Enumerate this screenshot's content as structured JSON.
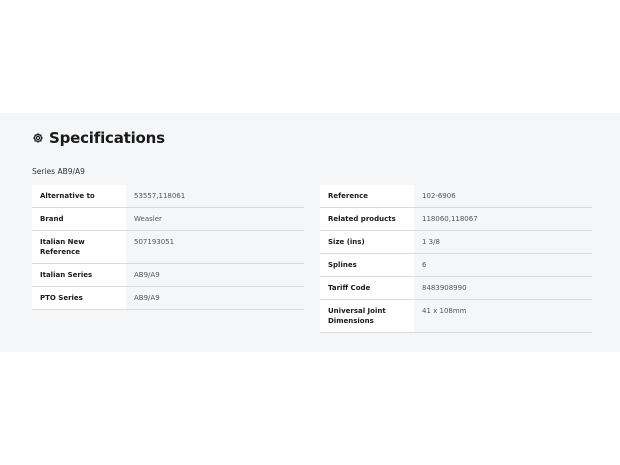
{
  "specs": {
    "title": "Specifications",
    "series_label": "Series AB9/A9",
    "left_rows": [
      {
        "key": "Alternative to",
        "value": "53557,118061"
      },
      {
        "key": "Brand",
        "value": "Weasler"
      },
      {
        "key": "Italian New Reference",
        "value": "507193051"
      },
      {
        "key": "Italian Series",
        "value": "AB9/A9"
      },
      {
        "key": "PTO Series",
        "value": "AB9/A9"
      }
    ],
    "right_rows": [
      {
        "key": "Reference",
        "value": "102-6906"
      },
      {
        "key": "Related products",
        "value": "118060,118067"
      },
      {
        "key": "Size (ins)",
        "value": "1 3/8"
      },
      {
        "key": "Splines",
        "value": "6"
      },
      {
        "key": "Tariff Code",
        "value": "8483908990"
      },
      {
        "key": "Universal Joint Dimensions",
        "value": "41 x 108mm"
      }
    ]
  },
  "colors": {
    "section_bg": "#f5f6f7",
    "key_bg": "#ffffff",
    "divider": "#d9dbdd"
  }
}
